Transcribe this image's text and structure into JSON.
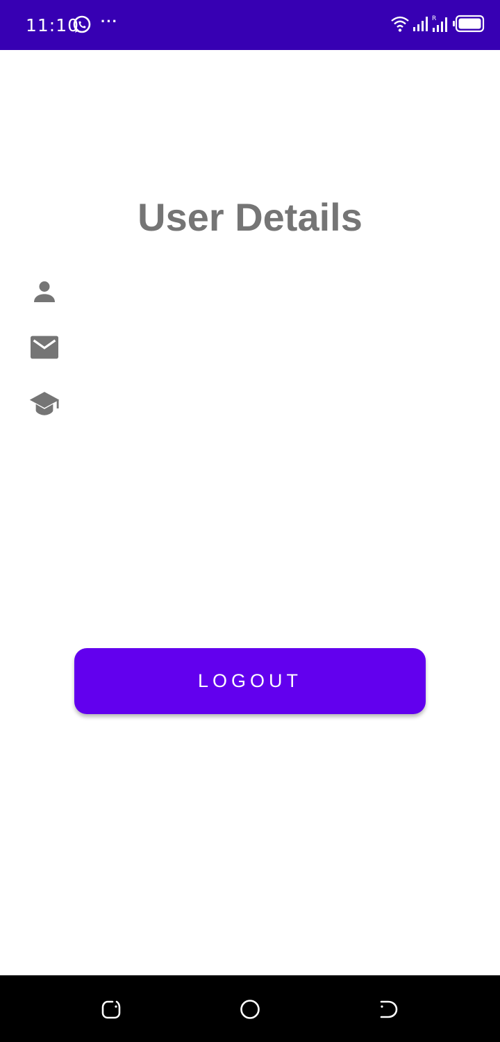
{
  "status_bar": {
    "time": "11:10",
    "more_indicator": "···",
    "background": "#3700b3",
    "icons": [
      "whatsapp-icon",
      "wifi-icon",
      "signal-icon",
      "battery-icon"
    ]
  },
  "page": {
    "title": "User Details",
    "rows": [
      {
        "icon": "person-icon",
        "value": ""
      },
      {
        "icon": "email-icon",
        "value": ""
      },
      {
        "icon": "graduation-cap-icon",
        "value": ""
      }
    ]
  },
  "actions": {
    "logout_label": "LOGOUT",
    "button_color": "#6200ee"
  },
  "nav_bar": {
    "items": [
      "recent-apps",
      "home",
      "back"
    ]
  }
}
